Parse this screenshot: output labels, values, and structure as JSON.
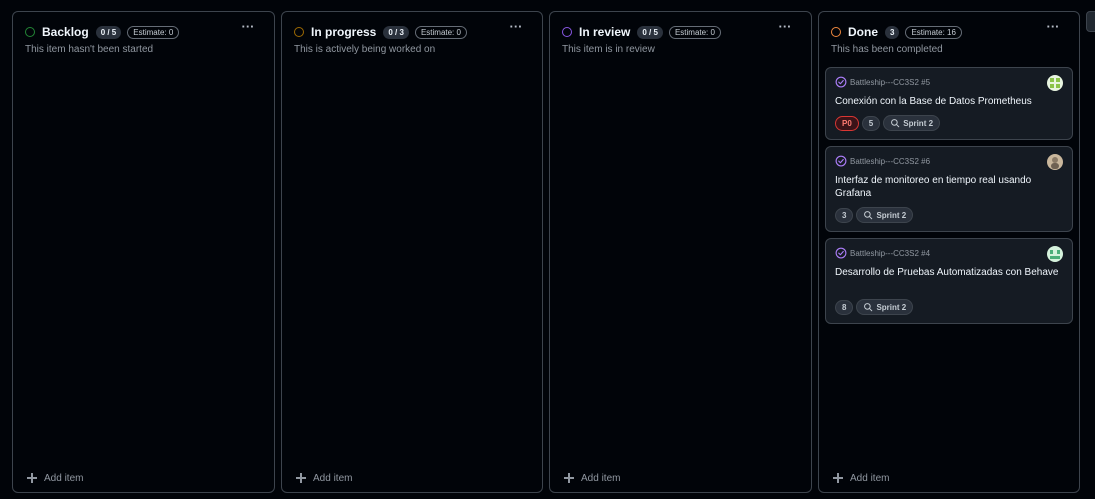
{
  "colors": {
    "backlog": "#238636",
    "in_progress": "#9e6a03",
    "in_review": "#8957e5",
    "done": "#f0883e",
    "priority_p0": "#da3633"
  },
  "columns": [
    {
      "title": "Backlog",
      "count": "0 / 5",
      "estimate": "Estimate: 0",
      "description": "This item hasn't been started",
      "add_item": "Add item"
    },
    {
      "title": "In progress",
      "count": "0 / 3",
      "estimate": "Estimate: 0",
      "description": "This is actively being worked on",
      "add_item": "Add item"
    },
    {
      "title": "In review",
      "count": "0 / 5",
      "estimate": "Estimate: 0",
      "description": "This item is in review",
      "add_item": "Add item"
    },
    {
      "title": "Done",
      "count": "3",
      "estimate": "Estimate: 16",
      "description": "This has been completed",
      "add_item": "Add item",
      "cards": [
        {
          "repo": "Battleship---CC3S2 #5",
          "title": "Conexión con la Base de Datos Prometheus",
          "priority": "P0",
          "estimate": "5",
          "sprint": "Sprint 2",
          "status_icon": "done-check-icon"
        },
        {
          "repo": "Battleship---CC3S2 #6",
          "title": "Interfaz de monitoreo en tiempo real usando Grafana",
          "estimate": "3",
          "sprint": "Sprint 2",
          "status_icon": "done-check-icon"
        },
        {
          "repo": "Battleship---CC3S2 #4",
          "title": "Desarrollo de Pruebas Automatizadas con Behave",
          "estimate": "8",
          "sprint": "Sprint 2",
          "status_icon": "done-check-icon"
        }
      ]
    }
  ],
  "icons": {
    "more": "kebab-menu-icon",
    "add": "plus-icon",
    "iteration": "iteration-icon",
    "avatar": "user-avatar"
  }
}
